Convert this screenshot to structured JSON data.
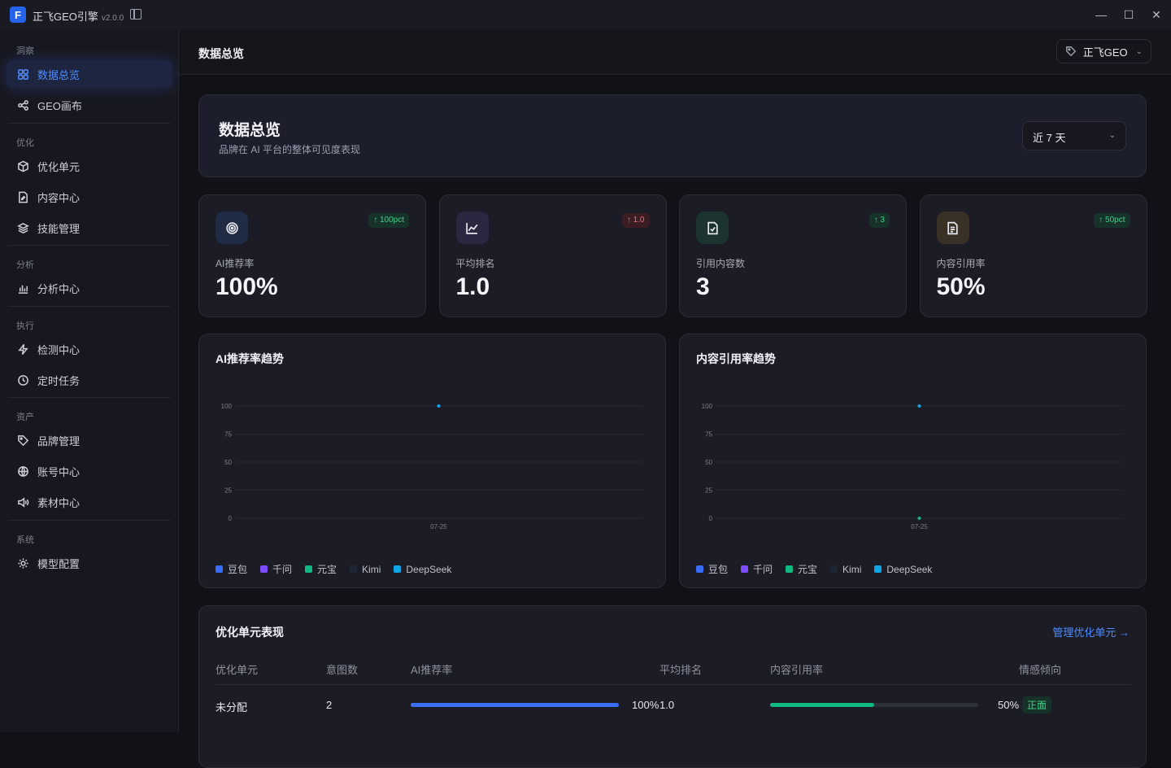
{
  "window": {
    "title": "正飞GEO引擎",
    "version": "v2.0.0",
    "minimize": "—",
    "maximize": "☐",
    "close": "✕"
  },
  "sidebar": {
    "sections": [
      {
        "label": "洞察",
        "items": [
          {
            "label": "数据总览",
            "icon": "grid-icon",
            "active": true
          },
          {
            "label": "GEO画布",
            "icon": "share-nodes-icon"
          }
        ]
      },
      {
        "label": "优化",
        "items": [
          {
            "label": "优化单元",
            "icon": "box-icon"
          },
          {
            "label": "内容中心",
            "icon": "file-edit-icon"
          },
          {
            "label": "技能管理",
            "icon": "layers-icon"
          }
        ]
      },
      {
        "label": "分析",
        "items": [
          {
            "label": "分析中心",
            "icon": "bar-chart-icon"
          }
        ]
      },
      {
        "label": "执行",
        "items": [
          {
            "label": "检测中心",
            "icon": "lightning-icon"
          },
          {
            "label": "定时任务",
            "icon": "clock-icon"
          }
        ]
      },
      {
        "label": "资产",
        "items": [
          {
            "label": "品牌管理",
            "icon": "tag-icon"
          },
          {
            "label": "账号中心",
            "icon": "globe-icon"
          },
          {
            "label": "素材中心",
            "icon": "speaker-icon"
          }
        ]
      },
      {
        "label": "系统",
        "items": [
          {
            "label": "模型配置",
            "icon": "gear-icon"
          }
        ]
      }
    ]
  },
  "topbar": {
    "title": "数据总览",
    "brand": "正飞GEO"
  },
  "overview": {
    "title": "数据总览",
    "subtitle": "品牌在 AI 平台的整体可见度表现",
    "range": "近 7 天"
  },
  "stats": [
    {
      "label": "AI推荐率",
      "value": "100%",
      "badge": "↑ 100pct",
      "trend": "up",
      "icon": "target-icon",
      "iconBg": "#1f2c44"
    },
    {
      "label": "平均排名",
      "value": "1.0",
      "badge": "↑ 1.0",
      "trend": "down",
      "icon": "line-chart-icon",
      "iconBg": "#2a2740"
    },
    {
      "label": "引用内容数",
      "value": "3",
      "badge": "↑ 3",
      "trend": "up",
      "icon": "file-check-icon",
      "iconBg": "#1d3330"
    },
    {
      "label": "内容引用率",
      "value": "50%",
      "badge": "↑ 50pct",
      "trend": "up",
      "icon": "document-icon",
      "iconBg": "#3a3126"
    }
  ],
  "chart_data": [
    {
      "type": "scatter",
      "title": "AI推荐率趋势",
      "x": [
        "07-25"
      ],
      "ylim": [
        0,
        100
      ],
      "yticks": [
        0,
        25,
        50,
        75,
        100
      ],
      "series": [
        {
          "name": "豆包",
          "color": "#3b6ef6",
          "values": [
            null
          ]
        },
        {
          "name": "千问",
          "color": "#7c4dff",
          "values": [
            null
          ]
        },
        {
          "name": "元宝",
          "color": "#10b981",
          "values": [
            null
          ]
        },
        {
          "name": "Kimi",
          "color": "#1e2533",
          "values": [
            null
          ]
        },
        {
          "name": "DeepSeek",
          "color": "#0ea5e9",
          "values": [
            100
          ]
        }
      ]
    },
    {
      "type": "scatter",
      "title": "内容引用率趋势",
      "x": [
        "07-25"
      ],
      "ylim": [
        0,
        100
      ],
      "yticks": [
        0,
        25,
        50,
        75,
        100
      ],
      "series": [
        {
          "name": "豆包",
          "color": "#3b6ef6",
          "values": [
            null
          ]
        },
        {
          "name": "千问",
          "color": "#7c4dff",
          "values": [
            null
          ]
        },
        {
          "name": "元宝",
          "color": "#10b981",
          "values": [
            0
          ]
        },
        {
          "name": "Kimi",
          "color": "#1e2533",
          "values": [
            null
          ]
        },
        {
          "name": "DeepSeek",
          "color": "#0ea5e9",
          "values": [
            100
          ]
        }
      ]
    }
  ],
  "table": {
    "title": "优化单元表现",
    "manage_link": "管理优化单元 →",
    "headers": [
      "优化单元",
      "意图数",
      "AI推荐率",
      "平均排名",
      "内容引用率",
      "情感倾向"
    ],
    "rows": [
      {
        "unit": "未分配",
        "intents": "2",
        "ai_rate": 100,
        "ai_rate_label": "100%",
        "rank": "1.0",
        "cite_rate": 50,
        "cite_rate_label": "50%",
        "sentiment": "正面"
      }
    ]
  }
}
